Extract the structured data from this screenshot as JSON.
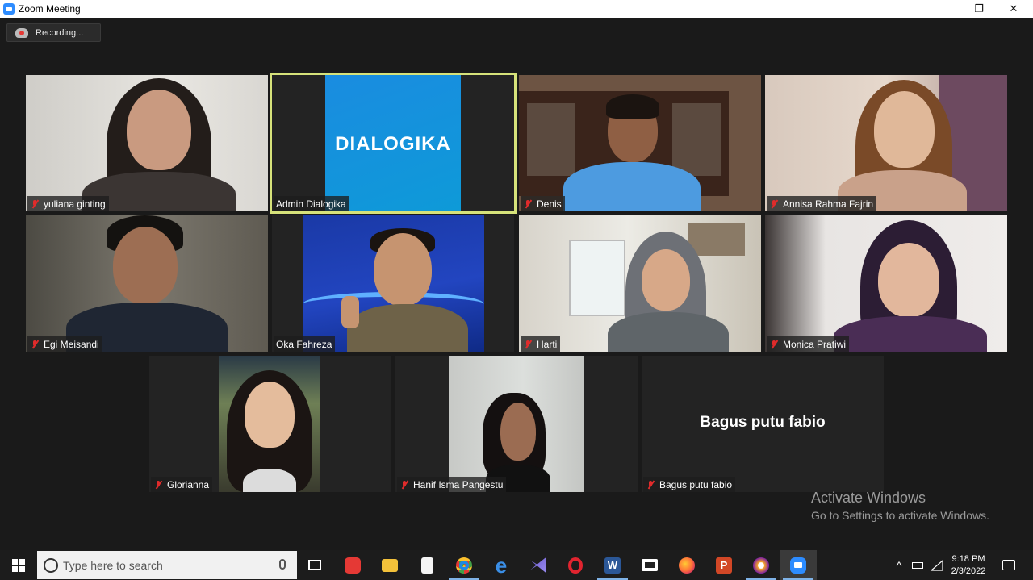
{
  "window": {
    "title": "Zoom Meeting",
    "minimize": "–",
    "restore": "❐",
    "close": "✕"
  },
  "recording": {
    "label": "Recording..."
  },
  "participants": [
    {
      "name": "yuliana ginting",
      "muted": true
    },
    {
      "name": "Admin Dialogika",
      "muted": false,
      "logo_text": "DIALOGIKA"
    },
    {
      "name": "Denis",
      "muted": true
    },
    {
      "name": "Annisa Rahma Fajrin",
      "muted": true
    },
    {
      "name": "Egi Meisandi",
      "muted": true
    },
    {
      "name": "Oka Fahreza",
      "muted": false
    },
    {
      "name": "Harti",
      "muted": true
    },
    {
      "name": "Monica Pratiwi",
      "muted": true
    },
    {
      "name": "Glorianna",
      "muted": true
    },
    {
      "name": "Hanif Isma Pangestu",
      "muted": true
    },
    {
      "name": "Bagus putu fabio",
      "muted": true,
      "video_off_label": "Bagus putu fabio"
    }
  ],
  "watermark": {
    "line1": "Activate Windows",
    "line2": "Go to Settings to activate Windows."
  },
  "taskbar": {
    "search_placeholder": "Type here to search",
    "time": "9:18 PM",
    "date": "2/3/2022",
    "tray_chevron": "^"
  },
  "colors": {
    "active_speaker": "#d6e27a",
    "muted_icon": "#e02b2b",
    "zoom_blue": "#2d8cff"
  }
}
